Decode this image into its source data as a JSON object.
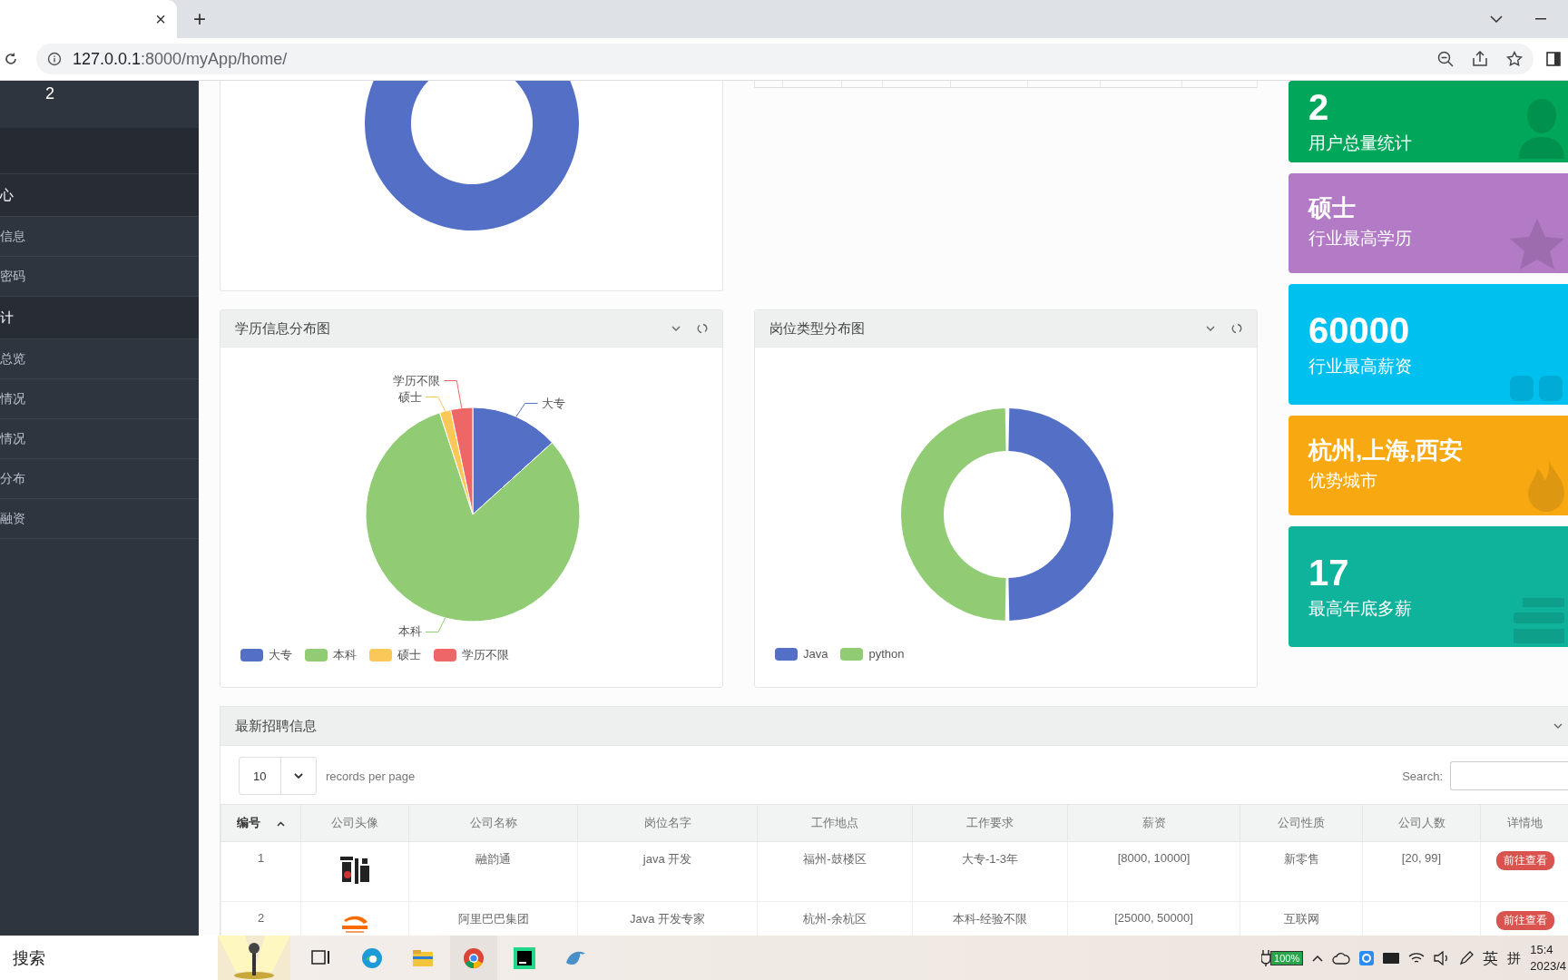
{
  "browser": {
    "tab_close": "×",
    "new_tab": "+",
    "url_host": "127.0.0.1",
    "url_path": ":8000/myApp/home/"
  },
  "sidebar": {
    "user_count": "2",
    "items": [
      {
        "label": "心",
        "kind": "header"
      },
      {
        "label": "信息",
        "kind": "item"
      },
      {
        "label": "密码",
        "kind": "item"
      },
      {
        "label": "计",
        "kind": "header"
      },
      {
        "label": "总览",
        "kind": "item"
      },
      {
        "label": "情况",
        "kind": "item"
      },
      {
        "label": "情况",
        "kind": "item"
      },
      {
        "label": "分布",
        "kind": "item"
      },
      {
        "label": "融资",
        "kind": "item"
      }
    ]
  },
  "charts": [
    {
      "title": "学历信息分布图",
      "legend": [
        {
          "label": "大专",
          "color": "#5470c6"
        },
        {
          "label": "本科",
          "color": "#91cc75"
        },
        {
          "label": "硕士",
          "color": "#fac858"
        },
        {
          "label": "学历不限",
          "color": "#ee6666"
        }
      ],
      "chart_data": {
        "type": "pie",
        "categories": [
          "大专",
          "本科",
          "硕士",
          "学历不限"
        ],
        "values": [
          13.3,
          81.7,
          1.7,
          3.3
        ]
      }
    },
    {
      "title": "岗位类型分布图",
      "legend": [
        {
          "color": "#5470c6"
        },
        {
          "color": "#91cc75"
        }
      ],
      "chart_data": {
        "type": "donut",
        "categories": [
          "Java",
          "python"
        ],
        "values": [
          50,
          50
        ]
      }
    }
  ],
  "stat_cards": [
    {
      "value": "2",
      "label": "用户总量统计",
      "color": "#00a65a",
      "kind": "user"
    },
    {
      "value": "硕士",
      "label": "行业最高学历",
      "color": "#b37bc6",
      "kind": "star"
    },
    {
      "value": "60000",
      "label": "行业最高薪资",
      "color": "#00c0ef",
      "kind": "blocks"
    },
    {
      "value": "杭州,上海,西安",
      "label": "优势城市",
      "color": "#f8a912",
      "kind": "flame"
    },
    {
      "value": "17",
      "label": "最高年底多薪",
      "color": "#0fb29a",
      "kind": "stack"
    }
  ],
  "table": {
    "title": "最新招聘信息",
    "page_size": "10",
    "per_page_label": "records per page",
    "search_label": "Search:",
    "columns": [
      {
        "label": "编号",
        "sorted": true
      },
      {
        "label": "公司头像",
        "sorted": false
      },
      {
        "label": "公司名称",
        "sorted": false
      },
      {
        "label": "岗位名字",
        "sorted": false
      },
      {
        "label": "工作地点",
        "sorted": false
      },
      {
        "label": "工作要求",
        "sorted": false
      },
      {
        "label": "薪资",
        "sorted": false
      },
      {
        "label": "公司性质",
        "sorted": false
      },
      {
        "label": "公司人数",
        "sorted": false
      },
      {
        "label": "详情地",
        "sorted": false
      }
    ],
    "rows": [
      {
        "id": "1",
        "company": "融韵通",
        "job": "java 开发",
        "city": "福州-鼓楼区",
        "requirement": "大专-1-3年",
        "salary": "[8000, 10000]",
        "nature": "新零售",
        "size": "[20, 99]",
        "action": "前往查看"
      },
      {
        "id": "2",
        "company": "阿里巴巴集团",
        "job": "Java 开发专家",
        "city": "杭州-余杭区",
        "requirement": "本科-经验不限",
        "salary": "[25000, 50000]",
        "nature": "互联网",
        "action": "前往查看"
      }
    ]
  },
  "taskbar": {
    "search": "搜索",
    "battery": "100%",
    "ime_lang": "英",
    "ime_mode": "拼",
    "time": "15:4",
    "date": "2023/4"
  }
}
